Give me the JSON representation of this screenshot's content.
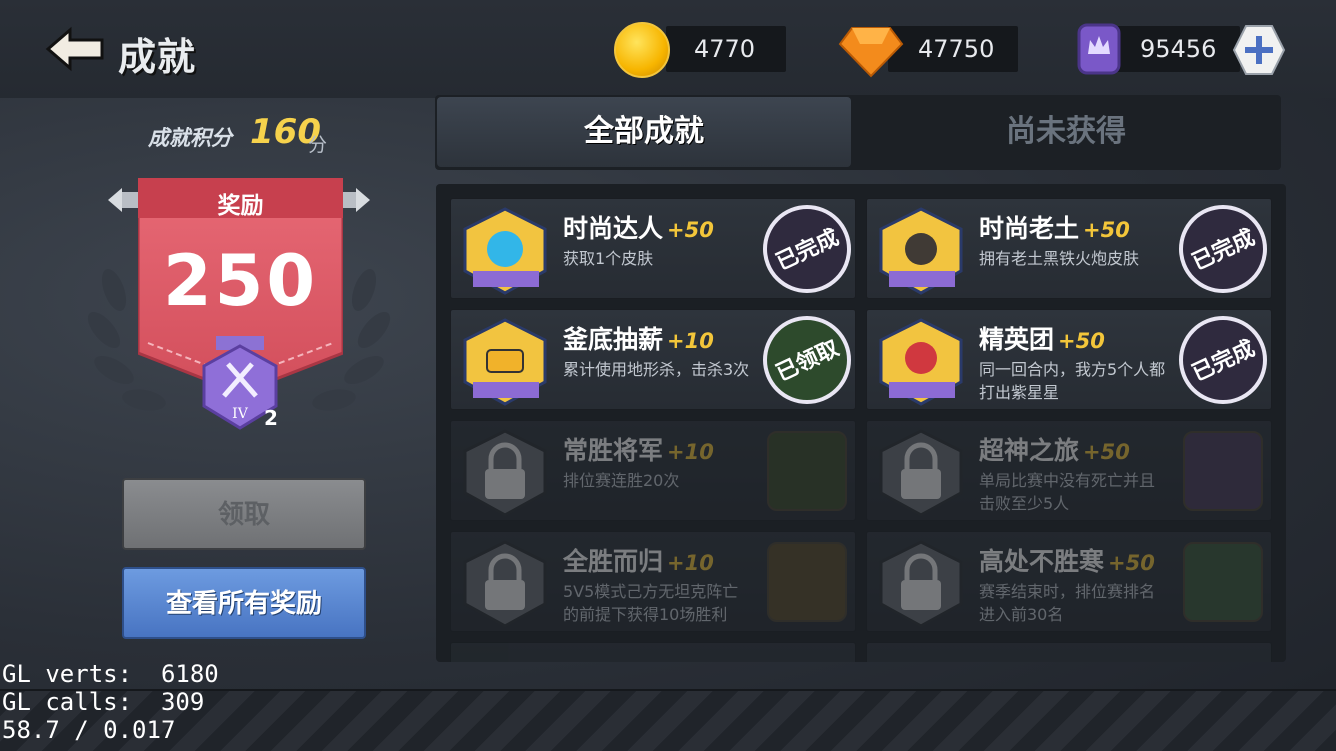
{
  "header": {
    "title": "成就"
  },
  "resources": {
    "gold": "4770",
    "diamond": "47750",
    "crown": "95456"
  },
  "score": {
    "label": "成就积分",
    "value": "160",
    "unit": "分"
  },
  "reward": {
    "title": "奖励",
    "value": "250",
    "medal_count": "2",
    "medal_level": "IV"
  },
  "buttons": {
    "claim": "领取",
    "view_all": "查看所有奖励"
  },
  "tabs": [
    {
      "label": "全部成就"
    },
    {
      "label": "尚未获得"
    }
  ],
  "achievements": [
    {
      "name": "时尚达人",
      "points": "+50",
      "desc": "获取1个皮肤",
      "status": "已完成"
    },
    {
      "name": "时尚老土",
      "points": "+50",
      "desc": "拥有老土黑铁火炮皮肤",
      "status": "已完成"
    },
    {
      "name": "釜底抽薪",
      "points": "+10",
      "desc": "累计使用地形杀，击杀3次",
      "status": "已领取"
    },
    {
      "name": "精英团",
      "points": "+50",
      "desc": "同一回合内，我方5个人都打出紫星星",
      "status": "已完成"
    },
    {
      "name": "常胜将军",
      "points": "+10",
      "desc": "排位赛连胜20次",
      "status": ""
    },
    {
      "name": "超神之旅",
      "points": "+50",
      "desc": "单局比赛中没有死亡并且击败至少5人",
      "status": ""
    },
    {
      "name": "全胜而归",
      "points": "+10",
      "desc": "5V5模式己方无坦克阵亡的前提下获得10场胜利",
      "status": ""
    },
    {
      "name": "高处不胜寒",
      "points": "+50",
      "desc": "赛季结束时，排位赛排名进入前30名",
      "status": ""
    }
  ],
  "debug": {
    "line1": "GL verts:  6180",
    "line2": "GL calls:  309",
    "line3": "58.7 / 0.017"
  }
}
